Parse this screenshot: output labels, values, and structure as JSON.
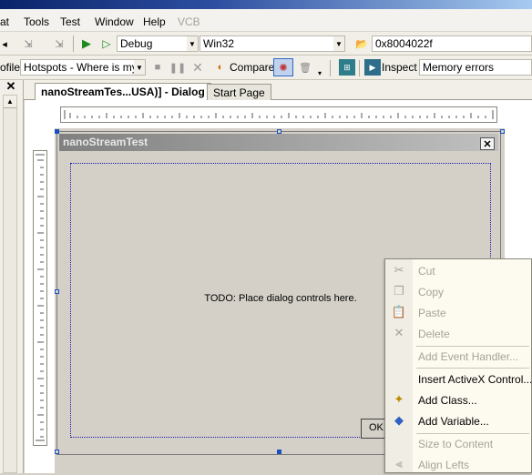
{
  "menubar": {
    "items": [
      {
        "label": "at",
        "enabled": true
      },
      {
        "label": "Tools",
        "enabled": true
      },
      {
        "label": "Test",
        "enabled": true
      },
      {
        "label": "Window",
        "enabled": true
      },
      {
        "label": "Help",
        "enabled": true
      },
      {
        "label": "VCB",
        "enabled": false
      }
    ]
  },
  "toolbar1": {
    "configuration": "Debug",
    "platform": "Win32",
    "address": "0x8004022f"
  },
  "toolbar2": {
    "profile_label": "ofile",
    "hotspots_combo": "Hotspots - Where is my p",
    "compare_label": "Compare",
    "inspect_label": "Inspect",
    "memory_errors": "Memory errors"
  },
  "tabs": [
    {
      "label": "nanoStreamTes...USA)] - Dialog",
      "active": true
    },
    {
      "label": "Start Page",
      "active": false
    }
  ],
  "dialog": {
    "title": "nanoStreamTest",
    "placeholder_text": "TODO: Place dialog controls here.",
    "ok_label": "OK"
  },
  "context_menu": {
    "items": [
      {
        "label": "Cut",
        "icon": "scissors-icon",
        "enabled": false
      },
      {
        "label": "Copy",
        "icon": "copy-icon",
        "enabled": false
      },
      {
        "label": "Paste",
        "icon": "paste-icon",
        "enabled": false
      },
      {
        "label": "Delete",
        "icon": "delete-x-icon",
        "enabled": false
      },
      {
        "label": "Add Event Handler...",
        "icon": "",
        "enabled": false
      },
      {
        "label": "Insert ActiveX Control...",
        "icon": "",
        "enabled": true
      },
      {
        "label": "Add Class...",
        "icon": "add-class-icon",
        "enabled": true
      },
      {
        "label": "Add Variable...",
        "icon": "add-variable-icon",
        "enabled": true
      },
      {
        "label": "Size to Content",
        "icon": "",
        "enabled": false
      },
      {
        "label": "Align Lefts",
        "icon": "align-lefts-icon",
        "enabled": false
      }
    ]
  },
  "colors": {
    "menu_bg": "#f3f2ee",
    "toolbar_bg": "#f1efe7",
    "dialog_face": "#d4d0c8",
    "context_menu_bg": "#fdfaf0",
    "selection_dots": "#1a1ab0"
  }
}
